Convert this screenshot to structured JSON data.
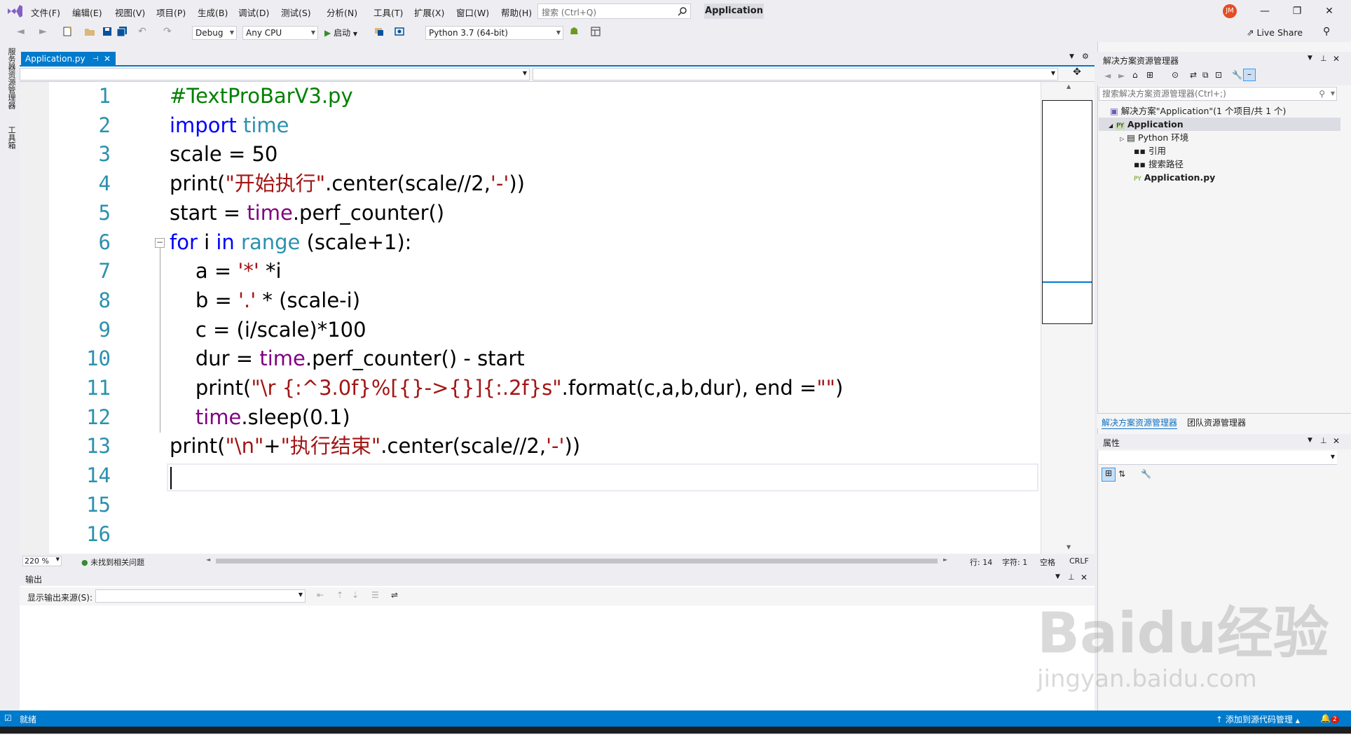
{
  "menubar": {
    "items": [
      "文件(F)",
      "编辑(E)",
      "视图(V)",
      "项目(P)",
      "生成(B)",
      "调试(D)",
      "测试(S)",
      "分析(N)",
      "工具(T)",
      "扩展(X)",
      "窗口(W)",
      "帮助(H)"
    ],
    "search_placeholder": "搜索 (Ctrl+Q)",
    "app_title": "Application",
    "avatar": "JM"
  },
  "toolbar": {
    "config": "Debug",
    "platform": "Any CPU",
    "start_label": "启动",
    "env": "Python 3.7 (64-bit)",
    "live_share": "Live Share"
  },
  "left_strip": {
    "server_explorer": "服务器资源管理器",
    "toolbox": "工具箱"
  },
  "document_tab": {
    "label": "Application.py"
  },
  "editor": {
    "line_numbers": [
      "1",
      "2",
      "3",
      "4",
      "5",
      "6",
      "7",
      "8",
      "9",
      "10",
      "11",
      "12",
      "13",
      "14",
      "15",
      "16"
    ],
    "lines": [
      [
        {
          "t": "#TextProBarV3.py",
          "c": "cm"
        }
      ],
      [
        {
          "t": "import ",
          "c": "kw"
        },
        {
          "t": "time",
          "c": "mod"
        }
      ],
      [
        {
          "t": "scale = 50",
          "c": ""
        }
      ],
      [
        {
          "t": "print(",
          "c": ""
        },
        {
          "t": "\"开始执行\"",
          "c": "str"
        },
        {
          "t": ".center(scale//2,",
          "c": ""
        },
        {
          "t": "'-'",
          "c": "str"
        },
        {
          "t": "))",
          "c": ""
        }
      ],
      [
        {
          "t": "start = ",
          "c": ""
        },
        {
          "t": "time",
          "c": "fn"
        },
        {
          "t": ".perf_counter()",
          "c": ""
        }
      ],
      [
        {
          "t": "for ",
          "c": "kw"
        },
        {
          "t": "i ",
          "c": ""
        },
        {
          "t": "in ",
          "c": "kw"
        },
        {
          "t": "range",
          "c": "mod"
        },
        {
          "t": " (scale+1):",
          "c": ""
        }
      ],
      [
        {
          "t": "    a = ",
          "c": ""
        },
        {
          "t": "'*'",
          "c": "str"
        },
        {
          "t": " *i",
          "c": ""
        }
      ],
      [
        {
          "t": "    b = ",
          "c": ""
        },
        {
          "t": "'.'",
          "c": "str"
        },
        {
          "t": " * (scale-i)",
          "c": ""
        }
      ],
      [
        {
          "t": "    c = (i/scale)*100",
          "c": ""
        }
      ],
      [
        {
          "t": "    dur = ",
          "c": ""
        },
        {
          "t": "time",
          "c": "fn"
        },
        {
          "t": ".perf_counter() - start",
          "c": ""
        }
      ],
      [
        {
          "t": "    print(",
          "c": ""
        },
        {
          "t": "\"\\r {:^3.0f}%[{}->{}]{:.2f}s\"",
          "c": "str"
        },
        {
          "t": ".format(c,a,b,dur), end =",
          "c": ""
        },
        {
          "t": "\"\"",
          "c": "str"
        },
        {
          "t": ")",
          "c": ""
        }
      ],
      [
        {
          "t": "    ",
          "c": ""
        },
        {
          "t": "time",
          "c": "fn"
        },
        {
          "t": ".sleep(0.1)",
          "c": ""
        }
      ],
      [
        {
          "t": "print(",
          "c": ""
        },
        {
          "t": "\"\\n\"",
          "c": "str"
        },
        {
          "t": "+",
          "c": ""
        },
        {
          "t": "\"执行结束\"",
          "c": "str"
        },
        {
          "t": ".center(scale//2,",
          "c": ""
        },
        {
          "t": "'-'",
          "c": "str"
        },
        {
          "t": "))",
          "c": ""
        }
      ],
      [],
      [],
      []
    ]
  },
  "editor_status": {
    "zoom": "220 %",
    "issues": "未找到相关问题",
    "line": "行: 14",
    "col": "字符: 1",
    "spaces": "空格",
    "eol": "CRLF"
  },
  "output": {
    "title": "输出",
    "source_label": "显示输出来源(S):"
  },
  "solution_explorer": {
    "title": "解决方案资源管理器",
    "search_placeholder": "搜索解决方案资源管理器(Ctrl+;)",
    "solution": "解决方案\"Application\"(1 个项目/共 1 个)",
    "project": "Application",
    "python_env": "Python 环境",
    "references": "引用",
    "search_paths": "搜索路径",
    "file": "Application.py",
    "tab_solution": "解决方案资源管理器",
    "tab_team": "团队资源管理器"
  },
  "properties": {
    "title": "属性"
  },
  "statusbar": {
    "ready": "就绪",
    "source_control": "添加到源代码管理",
    "notifications": "2"
  },
  "watermark": {
    "line1": "Baidu经验",
    "line2": "jingyan.baidu.com"
  }
}
